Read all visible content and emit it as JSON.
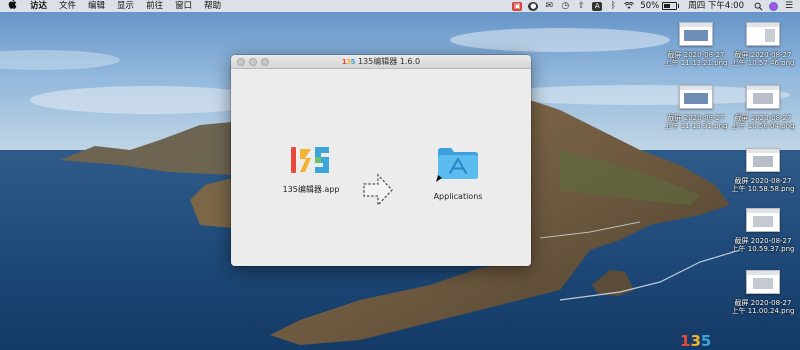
{
  "menubar": {
    "apple_icon": "apple-logo-icon",
    "items": [
      "访达",
      "文件",
      "编辑",
      "显示",
      "前往",
      "窗口",
      "帮助"
    ],
    "status_icons": [
      {
        "name": "app-red-icon",
        "color": "#d9453b"
      },
      {
        "name": "app-dark-circle-icon",
        "color": "#333333"
      },
      {
        "name": "wechat-icon",
        "color": "#3a3a3a"
      },
      {
        "name": "clock-icon",
        "color": "#3a3a3a"
      },
      {
        "name": "upload-icon",
        "color": "#3a3a3a"
      },
      {
        "name": "keyboard-a-icon",
        "color": "#3a3a3a"
      },
      {
        "name": "bluetooth-icon",
        "color": "#3a3a3a"
      },
      {
        "name": "wifi-icon",
        "color": "#3a3a3a"
      }
    ],
    "battery_percent": "50%",
    "battery_level": 0.5,
    "clock": "周四 下午4:00",
    "end_icons": [
      "search-icon",
      "siri-icon",
      "control-center-icon"
    ]
  },
  "window": {
    "title": "135编辑器 1.6.0",
    "logo_text": "135",
    "app_label": "135编辑器.app",
    "destination_label": "Applications"
  },
  "desktop_files": [
    {
      "name_line1": "截屏 2020-08-27",
      "name_line2": "上午 11.13.21.png"
    },
    {
      "name_line1": "截屏 2020-08-27",
      "name_line2": "上午 10.57.46.png"
    },
    {
      "name_line1": "截屏 2020-08-27",
      "name_line2": "上午 11.13.31.png"
    },
    {
      "name_line1": "截屏 2020-08-27",
      "name_line2": "上午 10.56.04.png"
    },
    {
      "name_line1": "截屏 2020-08-27",
      "name_line2": "上午 10.58.58.png"
    },
    {
      "name_line1": "截屏 2020-08-27",
      "name_line2": "上午 10.59.37.png"
    },
    {
      "name_line1": "截屏 2020-08-27",
      "name_line2": "上午 11.00.24.png"
    }
  ],
  "colors": {
    "logo_1": "#e8483b",
    "logo_3": "#f4b233",
    "logo_5": "#3aa6d9",
    "folder_blue": "#4eb4ec"
  }
}
